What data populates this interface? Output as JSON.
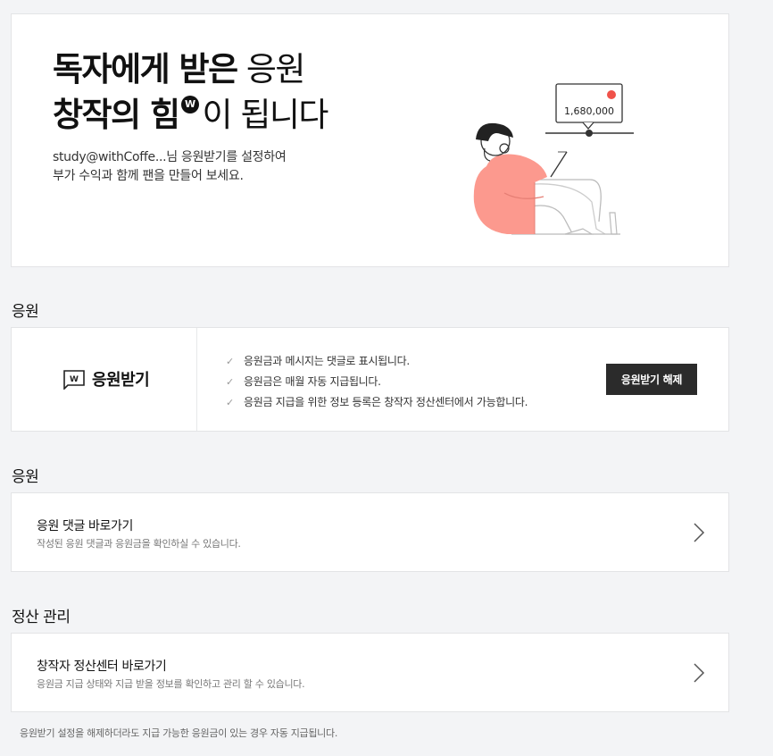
{
  "hero": {
    "line1_bold": "독자에게 받은",
    "line1_thin": "응원",
    "line2_bold": "창작의 힘",
    "line2_thin": "이 됩니다",
    "desc_line1": "study@withCoffe...님 응원받기를 설정하여",
    "desc_line2": "부가 수익과 함께 팬을 만들어 보세요.",
    "amount": "1,680,000"
  },
  "support_section": {
    "title": "응원",
    "brand_label": "응원받기",
    "checks": [
      "응원금과 메시지는 댓글로 표시됩니다.",
      "응원금은 매월 자동 지급됩니다.",
      "응원금 지급을 위한 정보 등록은 창작자 정산센터에서 가능합니다."
    ],
    "release_button": "응원받기 해제"
  },
  "comments_section": {
    "title": "응원",
    "link_title": "응원 댓글 바로가기",
    "link_desc": "작성된 응원 댓글과 응원금을 확인하실 수 있습니다."
  },
  "settlement_section": {
    "title": "정산 관리",
    "link_title": "창작자 정산센터 바로가기",
    "link_desc": "응원금 지급 상태와 지급 받을 정보를 확인하고 관리 할 수 있습니다."
  },
  "footnote": "응원받기 설정을 해제하더라도 지급 가능한 응원금이 있는 경우 자동 지급됩니다.",
  "colors": {
    "accent": "#fc998e",
    "badge_red": "#f0524a",
    "button_dark": "#2b2b2b"
  }
}
